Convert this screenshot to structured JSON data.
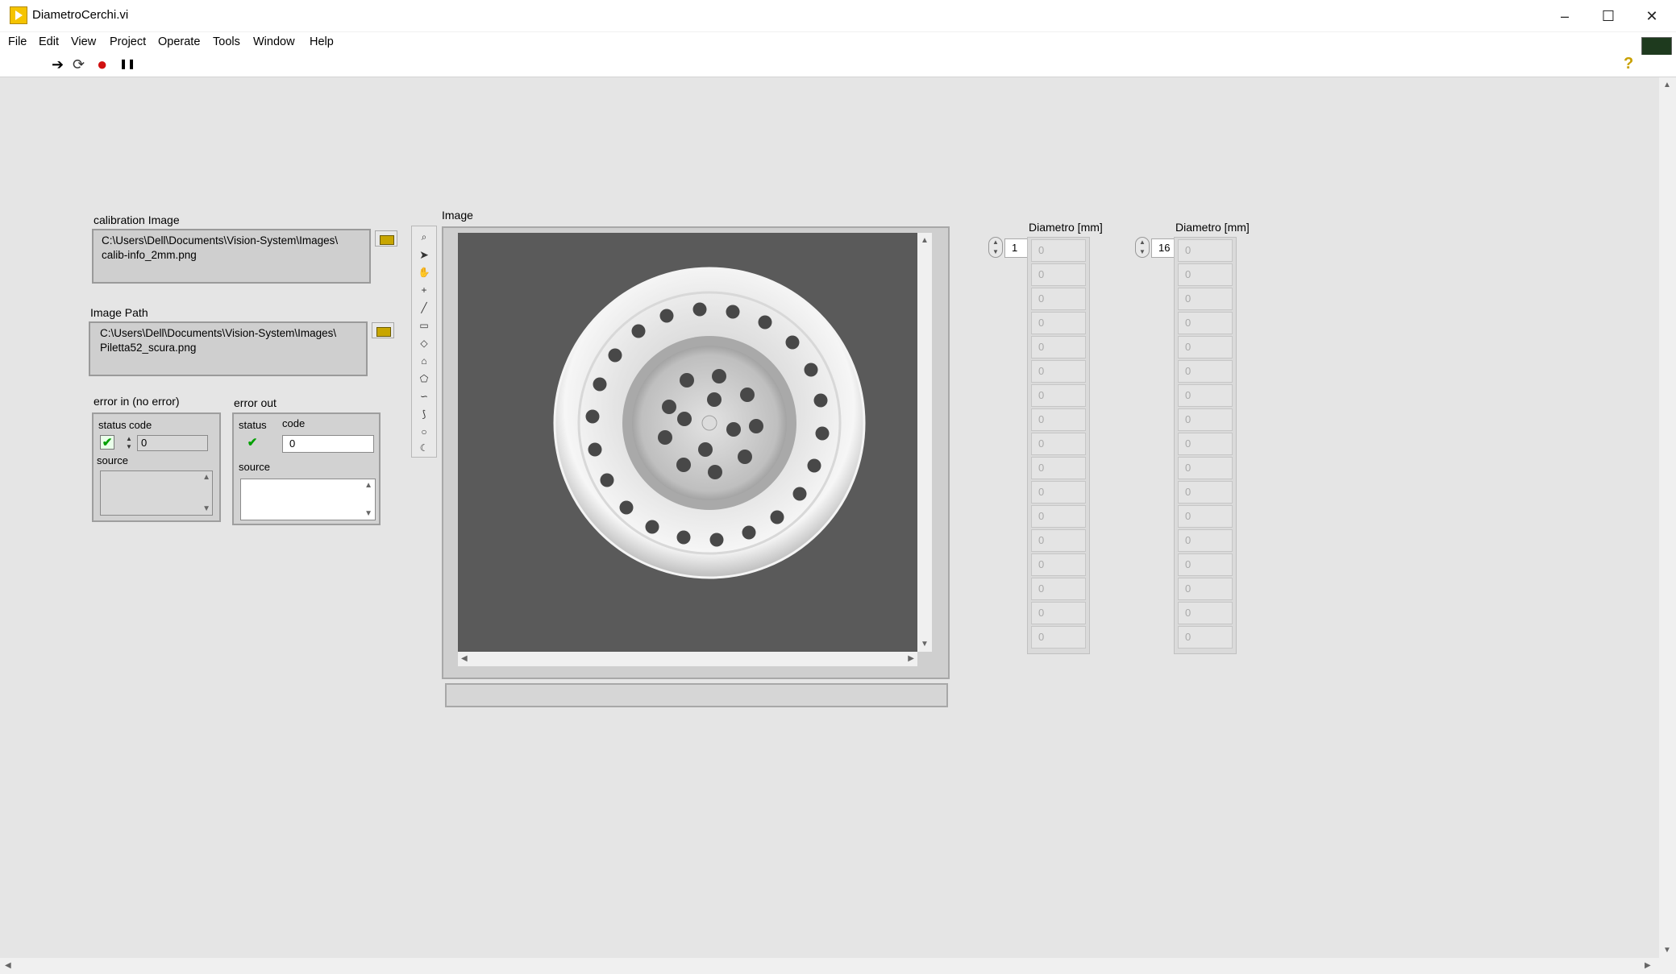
{
  "window": {
    "title": "DiametroCerchi.vi",
    "minimize": "–",
    "maximize": "☐",
    "close": "✕"
  },
  "menu": [
    "File",
    "Edit",
    "View",
    "Project",
    "Operate",
    "Tools",
    "Window",
    "Help"
  ],
  "toolbar": {
    "run": "➔",
    "run_continuous": "⟳",
    "abort": "●",
    "pause": "❚❚",
    "help": "?"
  },
  "calibration": {
    "label": "calibration Image",
    "path_line1": "C:\\Users\\Dell\\Documents\\Vision-System\\Images\\",
    "path_line2": "calib-info_2mm.png"
  },
  "image_path": {
    "label": "Image Path",
    "path_line1": "C:\\Users\\Dell\\Documents\\Vision-System\\Images\\",
    "path_line2": "Piletta52_scura.png"
  },
  "error_in": {
    "label": "error in (no error)",
    "status_label": "status",
    "code_label": "code",
    "code_value": "0",
    "source_label": "source",
    "status_check": "✔"
  },
  "error_out": {
    "label": "error out",
    "status_label": "status",
    "code_label": "code",
    "code_value": "0",
    "source_label": "source",
    "status_check": "✔"
  },
  "image_display": {
    "label": "Image"
  },
  "tools": [
    "zoom-icon",
    "pointer-icon",
    "pan-icon",
    "point-icon",
    "line-icon",
    "rectangle-icon",
    "rotated-rect-icon",
    "annulus-icon",
    "polygon-icon",
    "freehand-icon",
    "broken-line-icon",
    "oval-icon",
    "freehand-line-icon"
  ],
  "arrays": [
    {
      "label": "Diametro [mm]",
      "index": "1",
      "values": [
        "0",
        "0",
        "0",
        "0",
        "0",
        "0",
        "0",
        "0",
        "0",
        "0",
        "0",
        "0",
        "0",
        "0",
        "0",
        "0",
        "0"
      ]
    },
    {
      "label": "Diametro [mm]",
      "index": "16",
      "values": [
        "0",
        "0",
        "0",
        "0",
        "0",
        "0",
        "0",
        "0",
        "0",
        "0",
        "0",
        "0",
        "0",
        "0",
        "0",
        "0",
        "0"
      ]
    }
  ],
  "colors": {
    "workspace": "#e5e5e5",
    "control_gray": "#cfcfcf",
    "accent_check": "#00a000"
  }
}
